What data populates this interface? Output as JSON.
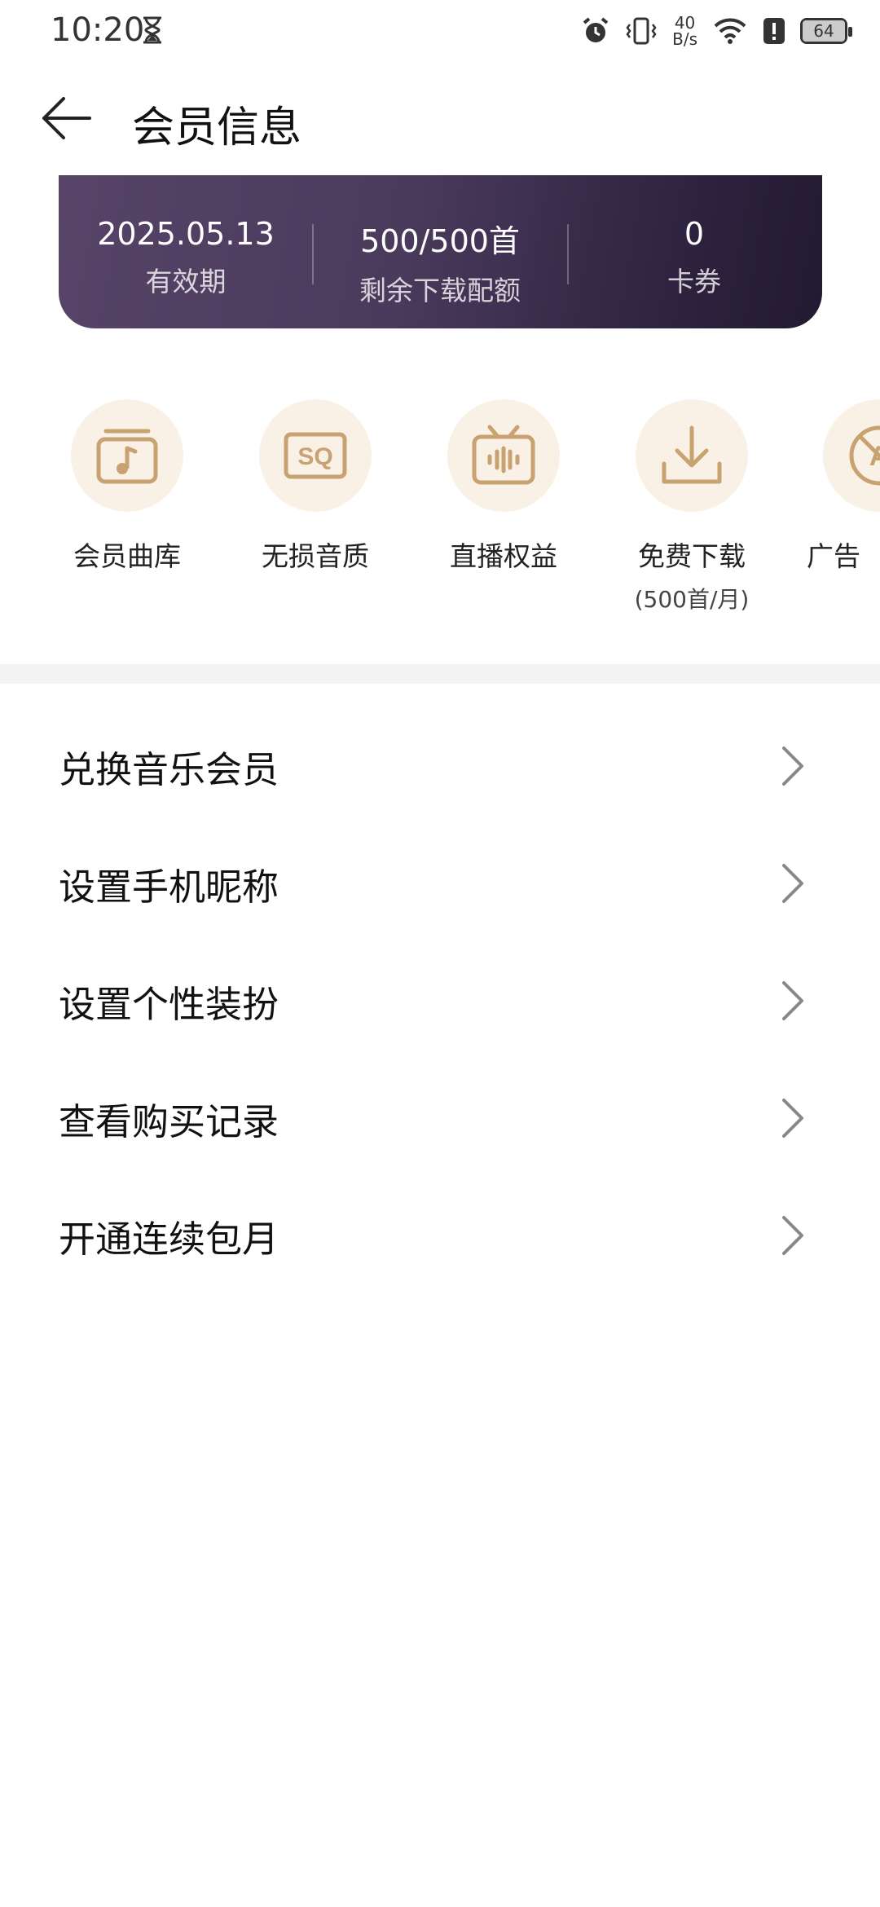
{
  "status_bar": {
    "time": "10:20",
    "net_speed_value": "40",
    "net_speed_unit": "B/s",
    "battery": "64",
    "icons": [
      "hourglass-icon",
      "alarm-icon",
      "vibrate-icon",
      "wifi-icon",
      "alert-icon",
      "battery-icon"
    ]
  },
  "header": {
    "title": "会员信息",
    "back_icon": "arrow-left-icon"
  },
  "member_card": {
    "stats": [
      {
        "value": "2025.05.13",
        "label": "有效期"
      },
      {
        "value": "500/500首",
        "label": "剩余下载配额"
      },
      {
        "value": "0",
        "label": "卡券"
      }
    ]
  },
  "benefits": [
    {
      "label": "会员曲库",
      "icon": "music-library-icon"
    },
    {
      "label": "无损音质",
      "icon": "sq-quality-icon"
    },
    {
      "label": "直播权益",
      "icon": "live-tv-icon"
    },
    {
      "label": "免费下载",
      "sub": "(500首/月)",
      "icon": "download-icon"
    },
    {
      "label": "广告",
      "icon": "no-ads-icon"
    }
  ],
  "menu": [
    {
      "label": "兑换音乐会员"
    },
    {
      "label": "设置手机昵称"
    },
    {
      "label": "设置个性装扮"
    },
    {
      "label": "查看购买记录"
    },
    {
      "label": "开通连续包月"
    }
  ],
  "colors": {
    "card_gradient_start": "#574468",
    "card_gradient_end": "#221a30",
    "benefit_icon": "#c8a270",
    "benefit_bg": "#f9f1e6",
    "chevron": "#888888"
  }
}
